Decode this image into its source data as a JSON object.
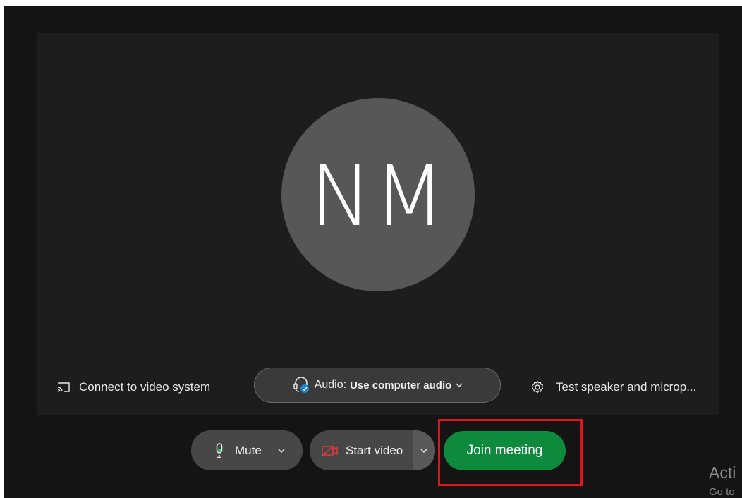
{
  "preview": {
    "avatar_initials": "NM"
  },
  "connect": {
    "label": "Connect to video system",
    "icon": "cast-icon"
  },
  "audio": {
    "prefix": "Audio:",
    "value": "Use computer audio",
    "icon": "headset-icon"
  },
  "test": {
    "label": "Test speaker and microp...",
    "icon": "gear-icon"
  },
  "controls": {
    "mute_label": "Mute",
    "start_video_label": "Start video",
    "join_label": "Join meeting"
  },
  "watermark": {
    "line1": "Acti",
    "line2": "Go to"
  },
  "colors": {
    "join_button": "#0e8a3c",
    "highlight_box": "#e0141c",
    "mic_accent": "#35c46b",
    "video_off": "#e03a3a",
    "audio_badge": "#1a86d9"
  }
}
